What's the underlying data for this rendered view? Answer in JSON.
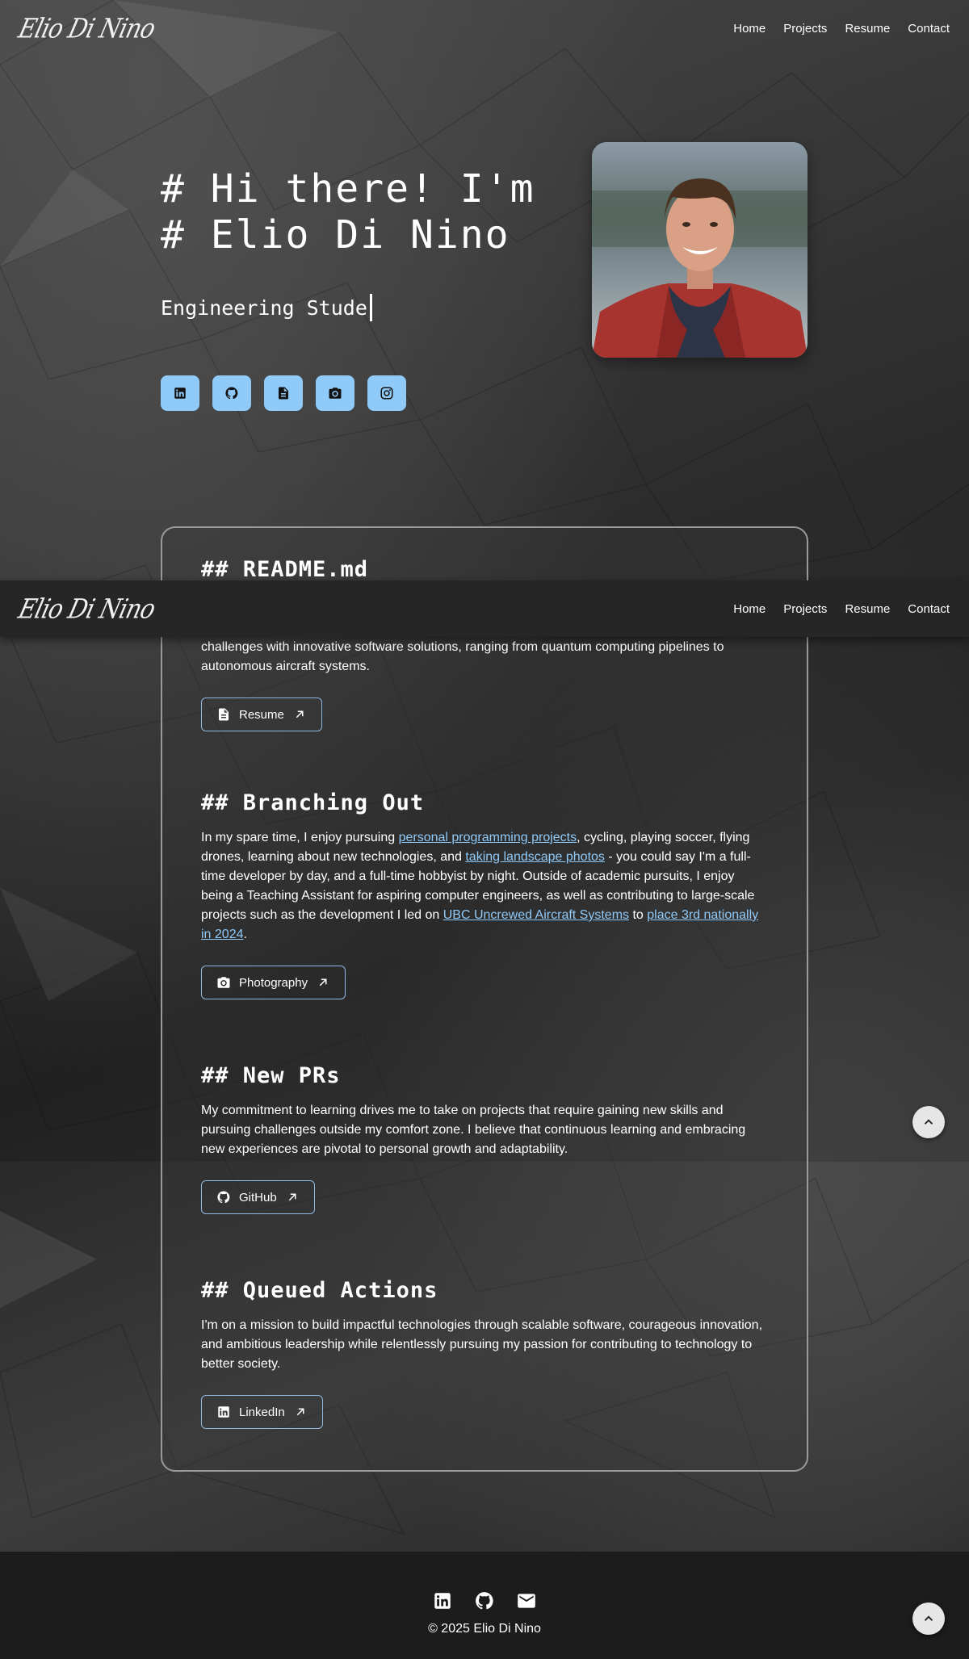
{
  "nav": {
    "logo": "Elio Di Nino",
    "links": [
      "Home",
      "Projects",
      "Resume",
      "Contact"
    ]
  },
  "hero": {
    "title_line1": "# Hi there! I'm",
    "title_line2": "# Elio Di Nino",
    "typed_text": "Engineering Stude",
    "social_icons": [
      "linkedin-icon",
      "github-icon",
      "document-icon",
      "camera-icon",
      "instagram-icon"
    ]
  },
  "readme": {
    "heading": "## README.md",
    "paragraph_visible": "challenges with innovative software solutions, ranging from quantum computing pipelines to autonomous aircraft systems.",
    "button_label": "Resume"
  },
  "branching": {
    "heading": "## Branching Out",
    "text_1": "In my spare time, I enjoy pursuing ",
    "link_1": "personal programming projects",
    "text_2": ", cycling, playing soccer, flying drones, learning about new technologies, and ",
    "link_2": "taking landscape photos",
    "text_3": " - you could say I'm a full-time developer by day, and a full-time hobbyist by night. Outside of academic pursuits, I enjoy being a Teaching Assistant for aspiring computer engineers, as well as contributing to large-scale projects such as the development I led on ",
    "link_3": "UBC Uncrewed Aircraft Systems",
    "text_4": " to ",
    "link_4": "place 3rd nationally in 2024",
    "text_5": ".",
    "button_label": "Photography"
  },
  "prs": {
    "heading": "## New PRs",
    "paragraph": "My commitment to learning drives me to take on projects that require gaining new skills and pursuing challenges outside my comfort zone. I believe that continuous learning and embracing new experiences are pivotal to personal growth and adaptability.",
    "button_label": "GitHub"
  },
  "queued": {
    "heading": "## Queued Actions",
    "paragraph": "I'm on a mission to build impactful technologies through scalable software, courageous innovation, and ambitious leadership while relentlessly pursuing my passion for contributing to technology to better society.",
    "button_label": "LinkedIn"
  },
  "footer": {
    "icons": [
      "linkedin-icon",
      "github-icon",
      "email-icon"
    ],
    "copyright": "© 2025 Elio Di Nino"
  },
  "colors": {
    "accent": "#90caf9",
    "footer_bg": "#1c1c1c",
    "sticky_nav_bg": "#262626"
  }
}
